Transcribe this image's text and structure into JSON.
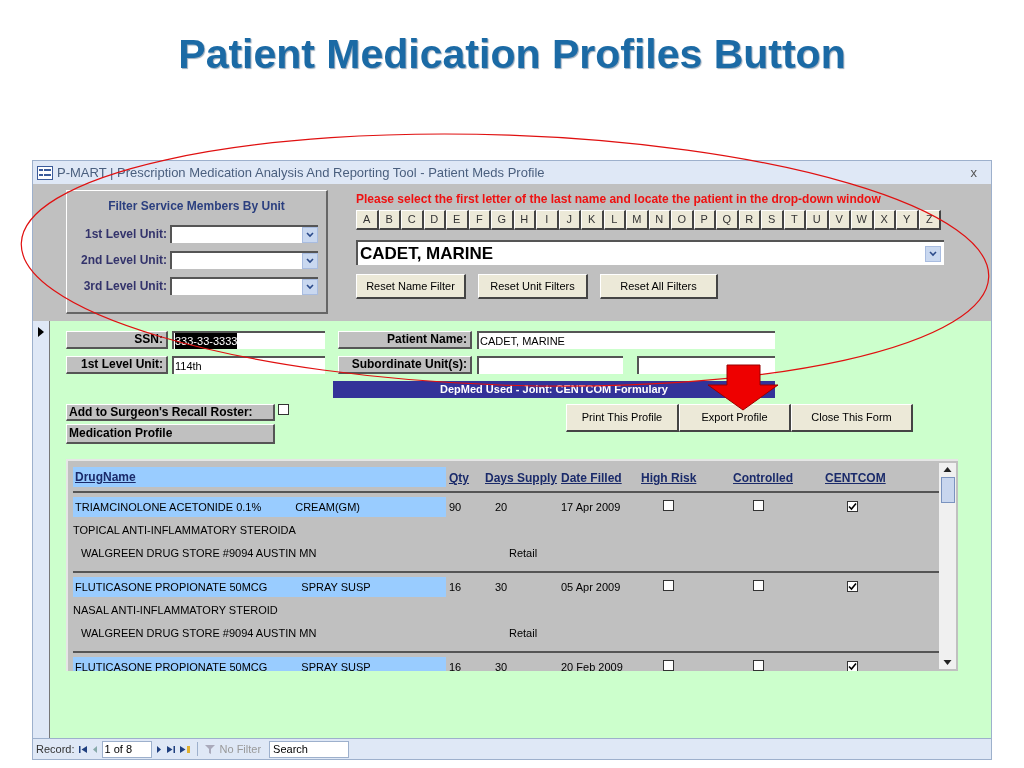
{
  "slide_title": "Patient Medication Profiles Button",
  "window": {
    "title": "P-MART | Prescription Medication Analysis And Reporting Tool - Patient Meds Profile",
    "close": "x"
  },
  "filter_panel": {
    "heading": "Filter Service Members By Unit",
    "units": [
      {
        "label": "1st Level Unit:"
      },
      {
        "label": "2nd Level Unit:"
      },
      {
        "label": "3rd Level Unit:"
      }
    ]
  },
  "instruction": "Please select the first letter of the last name and locate the patient in the drop-down window",
  "letters": [
    "A",
    "B",
    "C",
    "D",
    "E",
    "F",
    "G",
    "H",
    "I",
    "J",
    "K",
    "L",
    "M",
    "N",
    "O",
    "P",
    "Q",
    "R",
    "S",
    "T",
    "U",
    "V",
    "W",
    "X",
    "Y",
    "Z"
  ],
  "patient_combo": {
    "value": "CADET, MARINE"
  },
  "filter_buttons": [
    "Reset Name Filter",
    "Reset Unit Filters",
    "Reset All Filters"
  ],
  "record": {
    "ssn": {
      "label": "SSN:",
      "value": "333-33-3333"
    },
    "patient_name": {
      "label": "Patient Name:",
      "value": "CADET, MARINE"
    },
    "first_level_unit": {
      "label": "1st Level Unit:",
      "value": "114th"
    },
    "subordinate_units": {
      "label": "Subordinate Unit(s):"
    },
    "banner": "DepMed Used - Joint: CENTCOM Formulary",
    "recall_roster": {
      "label": "Add to Surgeon's Recall Roster:",
      "checked": false
    },
    "medication_profile": "Medication Profile"
  },
  "actions": [
    "Print This Profile",
    "Export Profile",
    "Close This Form"
  ],
  "table": {
    "columns": [
      "DrugName",
      "Qty",
      "Days Supply",
      "Date Filled",
      "High Risk",
      "Controlled",
      "CENTCOM"
    ],
    "rows": [
      {
        "drug": "TRIAMCINOLONE ACETONIDE 0.1%",
        "form": "CREAM(GM)",
        "qty": "90",
        "days_supply": "20",
        "date_filled": "17 Apr 2009",
        "high_risk": false,
        "controlled": false,
        "centcom": true,
        "category": "TOPICAL ANTI-INFLAMMATORY STEROIDA",
        "pharmacy": "WALGREEN DRUG STORE #9094 AUSTIN MN",
        "pharmacy_type": "Retail"
      },
      {
        "drug": "FLUTICASONE PROPIONATE 50MCG",
        "form": "SPRAY SUSP",
        "qty": "16",
        "days_supply": "30",
        "date_filled": "05 Apr 2009",
        "high_risk": false,
        "controlled": false,
        "centcom": true,
        "category": "NASAL ANTI-INFLAMMATORY STEROID",
        "pharmacy": "WALGREEN DRUG STORE #9094 AUSTIN MN",
        "pharmacy_type": "Retail"
      },
      {
        "drug": "FLUTICASONE PROPIONATE 50MCG",
        "form": "SPRAY SUSP",
        "qty": "16",
        "days_supply": "30",
        "date_filled": "20 Feb 2009",
        "high_risk": false,
        "controlled": false,
        "centcom": true
      }
    ]
  },
  "record_nav": {
    "label": "Record:",
    "position": "1 of 8",
    "filter": "No Filter",
    "search": "Search"
  }
}
